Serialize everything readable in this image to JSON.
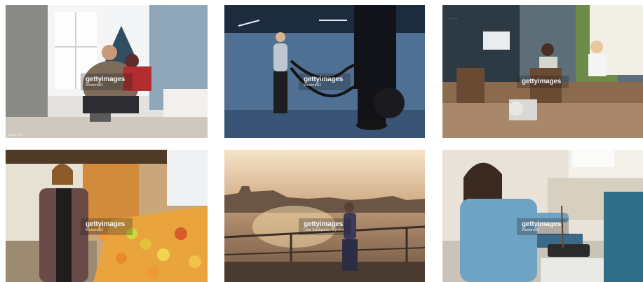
{
  "gallery": {
    "watermark_logo": "gettyimages",
    "tiles": [
      {
        "credit": "Westend61",
        "id": "1185179311",
        "scene": "couple-sitting-on-floor"
      },
      {
        "credit": "Westend61",
        "id": "",
        "scene": "woman-battle-ropes-gym"
      },
      {
        "credit": "",
        "id": "",
        "scene": "cafe-interior-friends"
      },
      {
        "credit": "Westend61",
        "id": "",
        "scene": "woman-fruit-market"
      },
      {
        "credit": "Luke Stackpoole / EyeEm",
        "id": "",
        "scene": "woman-running-riverside-sunset"
      },
      {
        "credit": "Westend61",
        "id": "",
        "scene": "woman-cooking-kitchen"
      }
    ]
  }
}
